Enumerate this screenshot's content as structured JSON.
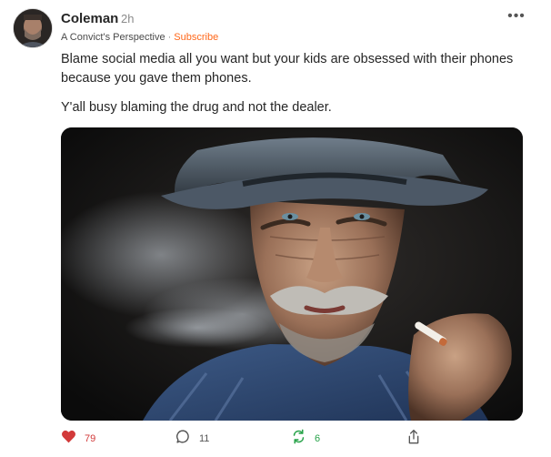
{
  "post": {
    "author": "Coleman",
    "time": "2h",
    "publication": "A Convict's Perspective",
    "separator": "·",
    "subscribe_label": "Subscribe",
    "more_label": "•••",
    "paragraphs": [
      "Blame social media all you want but your kids are obsessed with their phones because you gave them phones.",
      "Y'all busy blaming the drug and not the dealer."
    ],
    "image": {
      "subject": "Close-up portrait of an older man in a hat smoking a cigarette"
    }
  },
  "actions": {
    "likes": "79",
    "comments": "11",
    "restacks": "6"
  },
  "icons": {
    "like": "heart-icon",
    "comment": "comment-bubble-icon",
    "restack": "restack-icon",
    "share": "share-icon",
    "more": "more-dots-icon"
  },
  "colors": {
    "subscribe": "#ff6719",
    "like": "#d23a3a",
    "restack": "#28a34a"
  }
}
